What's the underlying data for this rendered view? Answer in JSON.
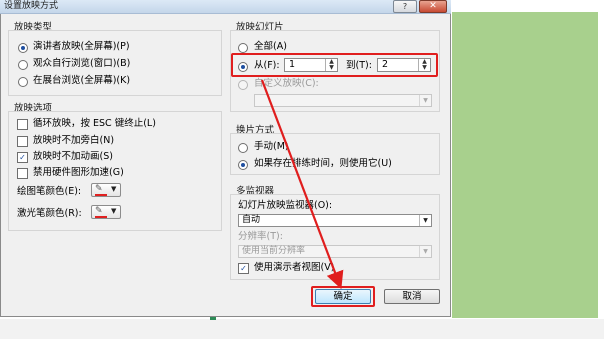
{
  "dialog": {
    "title": "设置放映方式",
    "help_label": "?",
    "close_label": "✕"
  },
  "show_type": {
    "heading": "放映类型",
    "options": [
      {
        "label": "演讲者放映(全屏幕)(P)",
        "selected": true
      },
      {
        "label": "观众自行浏览(窗口)(B)",
        "selected": false
      },
      {
        "label": "在展台浏览(全屏幕)(K)",
        "selected": false
      }
    ]
  },
  "show_options": {
    "heading": "放映选项",
    "checkboxes": [
      {
        "label": "循环放映，按 ESC 键终止(L)",
        "checked": false
      },
      {
        "label": "放映时不加旁白(N)",
        "checked": false
      },
      {
        "label": "放映时不加动画(S)",
        "checked": true
      },
      {
        "label": "禁用硬件图形加速(G)",
        "checked": false
      }
    ],
    "pen_color_label": "绘图笔颜色(E):",
    "laser_color_label": "激光笔颜色(R):",
    "pen_color": "#e02020",
    "laser_color": "#e02020"
  },
  "show_slides": {
    "heading": "放映幻灯片",
    "all_label": "全部(A)",
    "from_label": "从(F):",
    "from_value": "1",
    "to_label": "到(T):",
    "to_value": "2",
    "custom_label": "自定义放映(C):",
    "custom_value": ""
  },
  "advance": {
    "heading": "换片方式",
    "manual_label": "手动(M)",
    "timings_label": "如果存在排练时间，则使用它(U)"
  },
  "monitors": {
    "heading": "多监视器",
    "monitor_label": "幻灯片放映监视器(O):",
    "monitor_value": "自动",
    "resolution_label": "分辨率(T):",
    "resolution_value": "使用当前分辨率",
    "presenter_view_label": "使用演示者视图(V)",
    "presenter_view_checked": true
  },
  "buttons": {
    "ok_label": "确定",
    "cancel_label": "取消"
  },
  "icons": {
    "spin_up": "▲",
    "spin_down": "▼",
    "dropdown": "▼",
    "check": "✓",
    "pen": "✎"
  },
  "annotation_color": "#e01e1e",
  "background_color": "#a8d08d"
}
